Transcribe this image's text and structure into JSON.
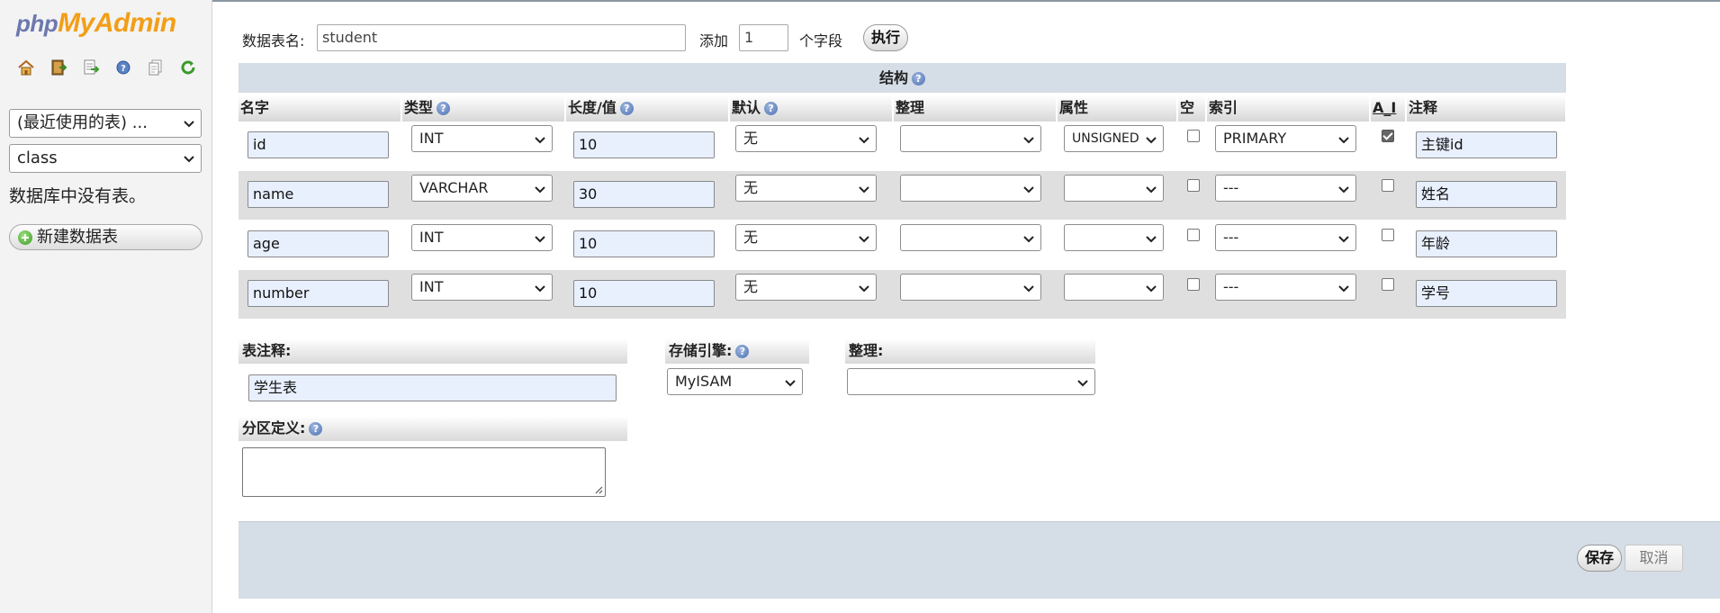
{
  "nav": {
    "logo_php": "php",
    "logo_myadmin": "MyAdmin",
    "icons": [
      "home-icon",
      "logout-icon",
      "sql-query-icon",
      "help-icon",
      "documentation-icon",
      "reload-icon"
    ],
    "recent_select": "(最近使用的表) ...",
    "db_select": "class",
    "no_tables": "数据库中没有表。",
    "new_table_button": "新建数据表"
  },
  "form": {
    "table_name_label": "数据表名:",
    "table_name_value": "student",
    "add_label": "添加",
    "add_count": "1",
    "fields_label": "个字段",
    "execute_button": "执行"
  },
  "structure": {
    "title": "结构",
    "columns": [
      "名字",
      "类型",
      "长度/值",
      "默认",
      "整理",
      "属性",
      "空",
      "索引",
      "A_I",
      "注释"
    ],
    "columns_help": [
      false,
      true,
      true,
      true,
      false,
      false,
      false,
      false,
      false,
      false
    ],
    "rows": [
      {
        "name": "id",
        "type": "INT",
        "length": "10",
        "default": "无",
        "collation": "",
        "attribute": "UNSIGNED",
        "null": false,
        "index": "PRIMARY",
        "ai": true,
        "comment": "主键id"
      },
      {
        "name": "name",
        "type": "VARCHAR",
        "length": "30",
        "default": "无",
        "collation": "",
        "attribute": "",
        "null": false,
        "index": "---",
        "ai": false,
        "comment": "姓名"
      },
      {
        "name": "age",
        "type": "INT",
        "length": "10",
        "default": "无",
        "collation": "",
        "attribute": "",
        "null": false,
        "index": "---",
        "ai": false,
        "comment": "年龄"
      },
      {
        "name": "number",
        "type": "INT",
        "length": "10",
        "default": "无",
        "collation": "",
        "attribute": "",
        "null": false,
        "index": "---",
        "ai": false,
        "comment": "学号"
      }
    ]
  },
  "table_options": {
    "comment_label": "表注释:",
    "comment_value": "学生表",
    "engine_label": "存储引擎:",
    "engine_value": "MyISAM",
    "collation_label": "整理:",
    "collation_value": "",
    "partition_label": "分区定义:"
  },
  "footer": {
    "save_button": "保存",
    "cancel_button": "取消"
  }
}
